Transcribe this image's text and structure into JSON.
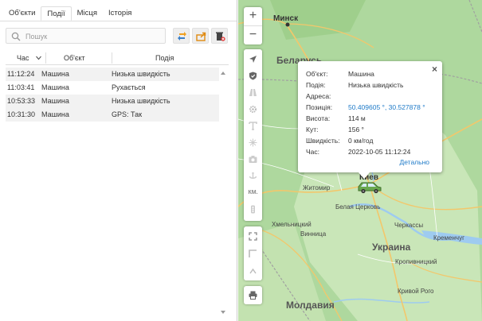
{
  "tabs": [
    "Об'єкти",
    "Події",
    "Місця",
    "Історія"
  ],
  "search": {
    "placeholder": "Пошук"
  },
  "grid": {
    "headers": {
      "time": "Час",
      "object": "Об'єкт",
      "event": "Подія"
    },
    "rows": [
      {
        "time": "11:12:24",
        "object": "Машина",
        "event": "Низька швидкість"
      },
      {
        "time": "11:03:41",
        "object": "Машина",
        "event": "Рухається"
      },
      {
        "time": "10:53:33",
        "object": "Машина",
        "event": "Низька швидкість"
      },
      {
        "time": "10:31:30",
        "object": "Машина",
        "event": "GPS: Так"
      }
    ]
  },
  "map": {
    "zoom_in": "+",
    "zoom_out": "−",
    "measure_label": "КМ.",
    "labels": {
      "minsk": "Минск",
      "belarus": "Беларусь",
      "kyiv": "Киев",
      "zhytomyr": "Житомир",
      "bila_tserkva": "Белая Церковь",
      "khmelnytskyi": "Хмельницкий",
      "vinnytsia": "Винница",
      "cherkasy": "Черкассы",
      "ukraine": "Украина",
      "kremenchuk": "Кременчуг",
      "kropyvnytskyi": "Кропивницкий",
      "kryvyi_rih": "Кривой Рого",
      "moldova": "Молдавия"
    }
  },
  "popup": {
    "close": "×",
    "fields": [
      {
        "key": "Об'єкт:",
        "value": "Машина"
      },
      {
        "key": "Подія:",
        "value": "Низька швидкість"
      },
      {
        "key": "Адреса:",
        "value": ""
      },
      {
        "key": "Позиція:",
        "value": "50.409605 °, 30.527878 °"
      },
      {
        "key": "Висота:",
        "value": "114 м"
      },
      {
        "key": "Кут:",
        "value": "156 °"
      },
      {
        "key": "Швидкість:",
        "value": "0 км/год"
      },
      {
        "key": "Час:",
        "value": "2022-10-05 11:12:24"
      }
    ],
    "details_link": "Детально"
  },
  "colors": {
    "map_land": "#aed89e",
    "link": "#1e7ac8",
    "row_alt": "#f2f2f2",
    "water": "#9ecbf0"
  }
}
